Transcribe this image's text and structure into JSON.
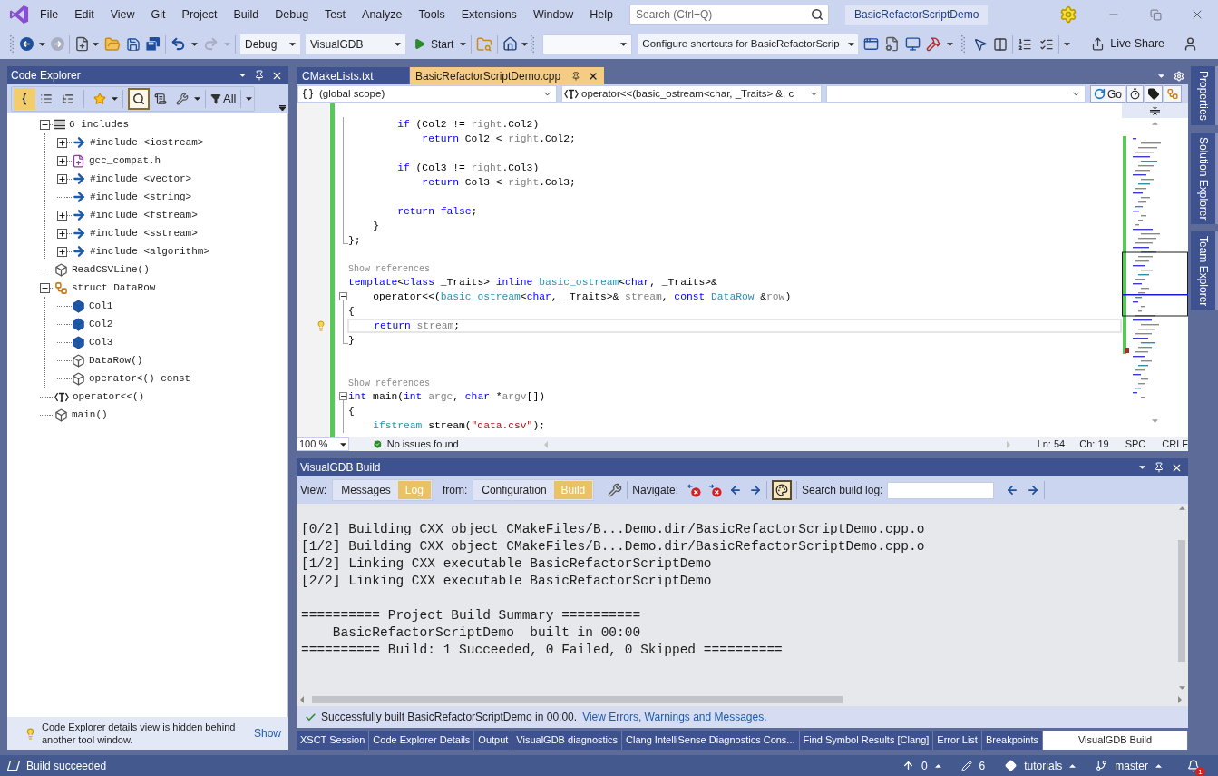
{
  "title_bar": {
    "menu": [
      "File",
      "Edit",
      "View",
      "Git",
      "Project",
      "Build",
      "Debug",
      "Test",
      "Analyze",
      "Tools",
      "Extensions",
      "Window",
      "Help"
    ],
    "search": {
      "placeholder": "Search (Ctrl+Q)"
    },
    "solution_name": "BasicRefactorScriptDemo"
  },
  "toolbar": {
    "history_buttons": [
      {
        "kind": "back",
        "disabled": false
      },
      {
        "kind": "forward",
        "disabled": true
      }
    ],
    "edit_buttons": [
      {
        "kind": "undo",
        "disabled": false
      },
      {
        "kind": "redo",
        "disabled": true
      }
    ],
    "configuration": "Debug",
    "platform": "VisualGDB",
    "start": "Start",
    "shortcuts": "Configure shortcuts for BasicRefactorScrip",
    "live_share": "Live Share"
  },
  "code_explorer": {
    "title": "Code Explorer",
    "toolbar_buttons": [
      {
        "kind": "brace",
        "selected": true
      },
      {
        "kind": "list",
        "selected": false
      },
      {
        "kind": "tree",
        "selected": false
      },
      {
        "kind": "star",
        "selected": false
      },
      {
        "kind": "search",
        "selected": true
      },
      {
        "kind": "scroll",
        "selected": false
      },
      {
        "kind": "wrench",
        "selected": false
      }
    ],
    "filter": "All",
    "tree": [
      {
        "label": "6 includes",
        "kind": "includes",
        "expandable": true,
        "expanded": true,
        "children": [
          {
            "label": "#include <iostream>",
            "kind": "include",
            "expandable": true,
            "expanded": false
          },
          {
            "label": "gcc_compat.h",
            "kind": "header",
            "expandable": true,
            "expanded": false
          },
          {
            "label": "#include <vector>",
            "kind": "include",
            "expandable": true,
            "expanded": false
          },
          {
            "label": "#include <string>",
            "kind": "include",
            "expandable": false
          },
          {
            "label": "#include <fstream>",
            "kind": "include",
            "expandable": true,
            "expanded": false
          },
          {
            "label": "#include <sstream>",
            "kind": "include",
            "expandable": true,
            "expanded": false
          },
          {
            "label": "#include <algorithm>",
            "kind": "include",
            "expandable": true,
            "expanded": false
          }
        ]
      },
      {
        "label": "ReadCSVLine()",
        "kind": "function",
        "expandable": false
      },
      {
        "label": "struct DataRow",
        "kind": "struct",
        "expandable": true,
        "expanded": true,
        "children": [
          {
            "label": "Col1",
            "kind": "field",
            "expandable": false
          },
          {
            "label": "Col2",
            "kind": "field",
            "expandable": false
          },
          {
            "label": "Col3",
            "kind": "field",
            "expandable": false
          },
          {
            "label": "DataRow()",
            "kind": "method",
            "expandable": false
          },
          {
            "label": "operator<() const",
            "kind": "method",
            "expandable": false
          }
        ]
      },
      {
        "label": "operator<<()",
        "kind": "template",
        "expandable": false
      },
      {
        "label": "main()",
        "kind": "function",
        "expandable": false
      }
    ],
    "notice": {
      "text": "Code Explorer details view is hidden behind another tool window.",
      "link": "Show"
    }
  },
  "editor": {
    "tabs": [
      {
        "label": "CMakeLists.txt",
        "selected": false
      },
      {
        "label": "BasicRefactorScriptDemo.cpp",
        "selected": true
      }
    ],
    "scope": "(global scope)",
    "member": "operator<<(basic_ostream<char, _Traits> &, c",
    "go_button": "Go",
    "sections": [
      {
        "kind": "region",
        "opens": false,
        "closes": true,
        "lines": [
          {
            "kind": "code",
            "current": false,
            "tokens": [
              {
                "kind": "keyword",
                "text": "        if"
              },
              {
                "kind": "plain",
                "text": " (Col2 != "
              },
              {
                "kind": "param",
                "text": "right"
              },
              {
                "kind": "plain",
                "text": ".Col2)"
              }
            ]
          },
          {
            "kind": "code",
            "current": false,
            "tokens": [
              {
                "kind": "keyword",
                "text": "            return"
              },
              {
                "kind": "plain",
                "text": " Col2 < "
              },
              {
                "kind": "param",
                "text": "right"
              },
              {
                "kind": "plain",
                "text": ".Col2;"
              }
            ]
          },
          {
            "kind": "blank",
            "current": false
          },
          {
            "kind": "code",
            "current": false,
            "tokens": [
              {
                "kind": "keyword",
                "text": "        if"
              },
              {
                "kind": "plain",
                "text": " (Col3 != "
              },
              {
                "kind": "param",
                "text": "right"
              },
              {
                "kind": "plain",
                "text": ".Col3)"
              }
            ]
          },
          {
            "kind": "code",
            "current": false,
            "tokens": [
              {
                "kind": "keyword",
                "text": "            return"
              },
              {
                "kind": "plain",
                "text": " Col3 < "
              },
              {
                "kind": "param",
                "text": "right"
              },
              {
                "kind": "plain",
                "text": ".Col3;"
              }
            ]
          },
          {
            "kind": "blank",
            "current": false
          },
          {
            "kind": "code",
            "current": false,
            "tokens": [
              {
                "kind": "keyword",
                "text": "        return false"
              },
              {
                "kind": "plain",
                "text": ";"
              }
            ]
          },
          {
            "kind": "code",
            "current": false,
            "tokens": [
              {
                "kind": "plain",
                "text": "    }"
              }
            ]
          },
          {
            "kind": "code",
            "current": false,
            "tokens": [
              {
                "kind": "plain",
                "text": "};"
              }
            ]
          }
        ]
      },
      {
        "kind": "plain",
        "lines": [
          {
            "kind": "blank",
            "current": false
          },
          {
            "kind": "lens",
            "current": false,
            "text": "Show references"
          },
          {
            "kind": "code",
            "current": false,
            "tokens": [
              {
                "kind": "keyword",
                "text": "template"
              },
              {
                "kind": "plain",
                "text": "<"
              },
              {
                "kind": "keyword",
                "text": "class"
              },
              {
                "kind": "plain",
                "text": " _Traits> "
              },
              {
                "kind": "keyword",
                "text": "inline"
              },
              {
                "kind": "type",
                "text": " basic_ostream"
              },
              {
                "kind": "plain",
                "text": "<"
              },
              {
                "kind": "keyword",
                "text": "char"
              },
              {
                "kind": "plain",
                "text": ", _Traits>&"
              }
            ]
          }
        ]
      },
      {
        "kind": "region",
        "opens": true,
        "expanded": true,
        "closes": true,
        "lines": [
          {
            "kind": "code",
            "current": false,
            "tokens": [
              {
                "kind": "plain",
                "text": "    operator<<("
              },
              {
                "kind": "type",
                "text": "basic_ostream"
              },
              {
                "kind": "plain",
                "text": "<"
              },
              {
                "kind": "keyword",
                "text": "char"
              },
              {
                "kind": "plain",
                "text": ", _Traits>& "
              },
              {
                "kind": "param",
                "text": "stream"
              },
              {
                "kind": "plain",
                "text": ", "
              },
              {
                "kind": "keyword",
                "text": "const"
              },
              {
                "kind": "type",
                "text": " DataRow"
              },
              {
                "kind": "plain",
                "text": " &"
              },
              {
                "kind": "param",
                "text": "row"
              },
              {
                "kind": "plain",
                "text": ")"
              }
            ]
          },
          {
            "kind": "code",
            "current": false,
            "tokens": [
              {
                "kind": "plain",
                "text": "{"
              }
            ]
          },
          {
            "kind": "code",
            "current": true,
            "tokens": [
              {
                "kind": "keyword",
                "text": "    return"
              },
              {
                "kind": "param",
                "text": " stream"
              },
              {
                "kind": "plain",
                "text": ";"
              }
            ]
          },
          {
            "kind": "code",
            "current": false,
            "tokens": [
              {
                "kind": "plain",
                "text": "}"
              }
            ]
          }
        ]
      },
      {
        "kind": "plain",
        "lines": [
          {
            "kind": "blank",
            "current": false
          },
          {
            "kind": "blank",
            "current": false
          },
          {
            "kind": "lens",
            "current": false,
            "text": "Show references"
          }
        ]
      },
      {
        "kind": "region",
        "opens": true,
        "expanded": true,
        "closes": false,
        "lines": [
          {
            "kind": "code",
            "current": false,
            "tokens": [
              {
                "kind": "keyword",
                "text": "int"
              },
              {
                "kind": "plain",
                "text": " main("
              },
              {
                "kind": "keyword",
                "text": "int"
              },
              {
                "kind": "param",
                "text": " argc"
              },
              {
                "kind": "plain",
                "text": ", "
              },
              {
                "kind": "keyword",
                "text": "char"
              },
              {
                "kind": "plain",
                "text": " *"
              },
              {
                "kind": "param",
                "text": "argv"
              },
              {
                "kind": "plain",
                "text": "[])"
              }
            ]
          },
          {
            "kind": "code",
            "current": false,
            "tokens": [
              {
                "kind": "plain",
                "text": "{"
              }
            ]
          },
          {
            "kind": "code",
            "current": false,
            "tokens": [
              {
                "kind": "type",
                "text": "    ifstream"
              },
              {
                "kind": "plain",
                "text": " stream("
              },
              {
                "kind": "string",
                "text": "\"data.csv\""
              },
              {
                "kind": "plain",
                "text": ");"
              }
            ]
          }
        ]
      }
    ],
    "zoom": "100 %",
    "issues": "No issues found",
    "line_number": "Ln: 54",
    "column": "Ch: 19",
    "indentation": "SPC",
    "line_ending": "CRLF"
  },
  "build_panel": {
    "title": "VisualGDB Build",
    "view_label": "View:",
    "view_modes": [
      {
        "label": "Messages",
        "selected": false
      },
      {
        "label": "Log",
        "selected": true
      }
    ],
    "from_label": "from:",
    "sources": [
      {
        "label": "Configuration",
        "selected": false
      },
      {
        "label": "Build",
        "selected": true
      }
    ],
    "navigate_label": "Navigate:",
    "highlight_toggle": {
      "selected": true
    },
    "search_label": "Search build log:",
    "log_blocks": [
      [
        "[0/2] Building CXX object CMakeFiles/B...Demo.dir/BasicRefactorScriptDemo.cpp.o",
        "[1/2] Building CXX object CMakeFiles/B...Demo.dir/BasicRefactorScriptDemo.cpp.o",
        "[1/2] Linking CXX executable BasicRefactorScriptDemo",
        "[2/2] Linking CXX executable BasicRefactorScriptDemo"
      ],
      [
        "========== Project Build Summary ==========",
        "    BasicRefactorScriptDemo  built in 00:00",
        "========== Build: 1 Succeeded, 0 Failed, 0 Skipped =========="
      ]
    ],
    "result": {
      "message": "Successfully built BasicRefactorScriptDemo in 00:00.",
      "link": "View Errors, Warnings and Messages."
    }
  },
  "tool_tabs": [
    {
      "label": "XSCT Session",
      "selected": false
    },
    {
      "label": "Code Explorer Details",
      "selected": false
    },
    {
      "label": "Output",
      "selected": false
    },
    {
      "label": "VisualGDB diagnostics",
      "selected": false
    },
    {
      "label": "Clang IntelliSense Diagnostics Cons...",
      "selected": false
    },
    {
      "label": "Find Symbol Results [Clang]",
      "selected": false
    },
    {
      "label": "Error List",
      "selected": false
    },
    {
      "label": "Breakpoints",
      "selected": false
    },
    {
      "label": "VisualGDB Build",
      "selected": true
    }
  ],
  "side_tabs": [
    "Properties",
    "Solution Explorer",
    "Team Explorer"
  ],
  "status_bar": {
    "message": "Build succeeded",
    "unpushed": "0",
    "changes": "6",
    "repository": "tutorials",
    "branch": "master",
    "notifications": "1"
  }
}
